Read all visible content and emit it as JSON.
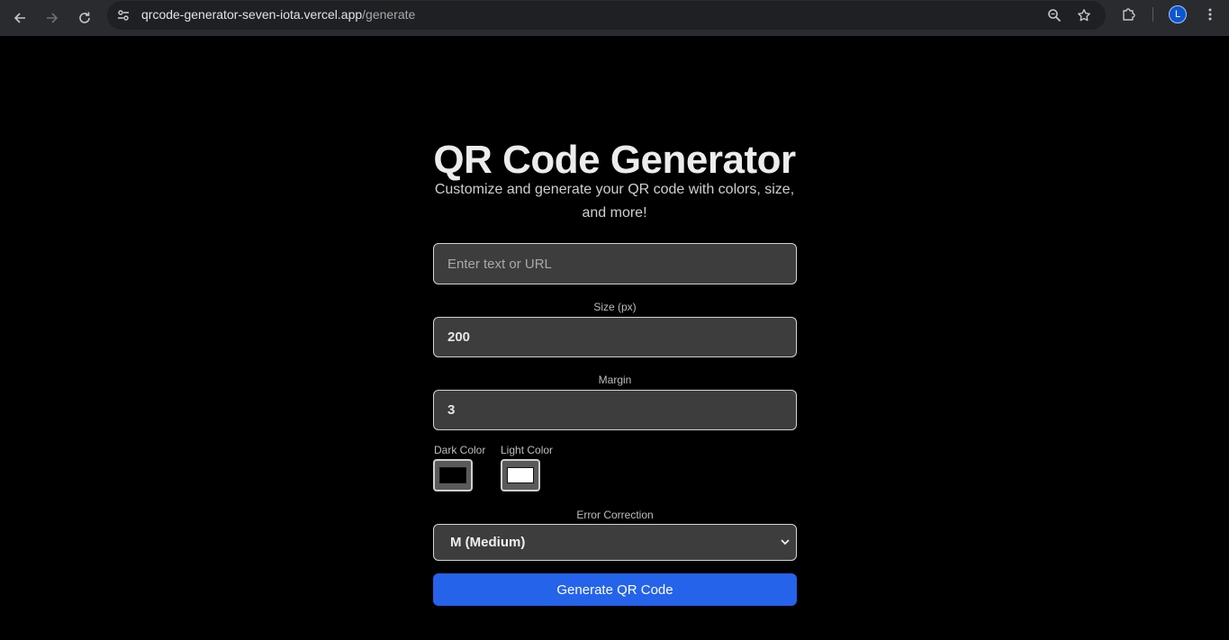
{
  "browser": {
    "url_host": "qrcode-generator-seven-iota.vercel.app",
    "url_path": "/generate",
    "profile_initial": "L"
  },
  "page": {
    "title": "QR Code Generator",
    "subtitle": "Customize and generate your QR code with colors, size, and more!"
  },
  "form": {
    "text_input": {
      "placeholder": "Enter text or URL",
      "value": ""
    },
    "size": {
      "label": "Size (px)",
      "value": "200"
    },
    "margin": {
      "label": "Margin",
      "value": "3"
    },
    "dark_color": {
      "label": "Dark Color",
      "value": "#000000"
    },
    "light_color": {
      "label": "Light Color",
      "value": "#ffffff"
    },
    "error_correction": {
      "label": "Error Correction",
      "selected": "M (Medium)"
    },
    "generate_label": "Generate QR Code"
  },
  "colors": {
    "accent": "#2563eb",
    "background": "#000000",
    "field_bg": "#3d3d3d"
  }
}
